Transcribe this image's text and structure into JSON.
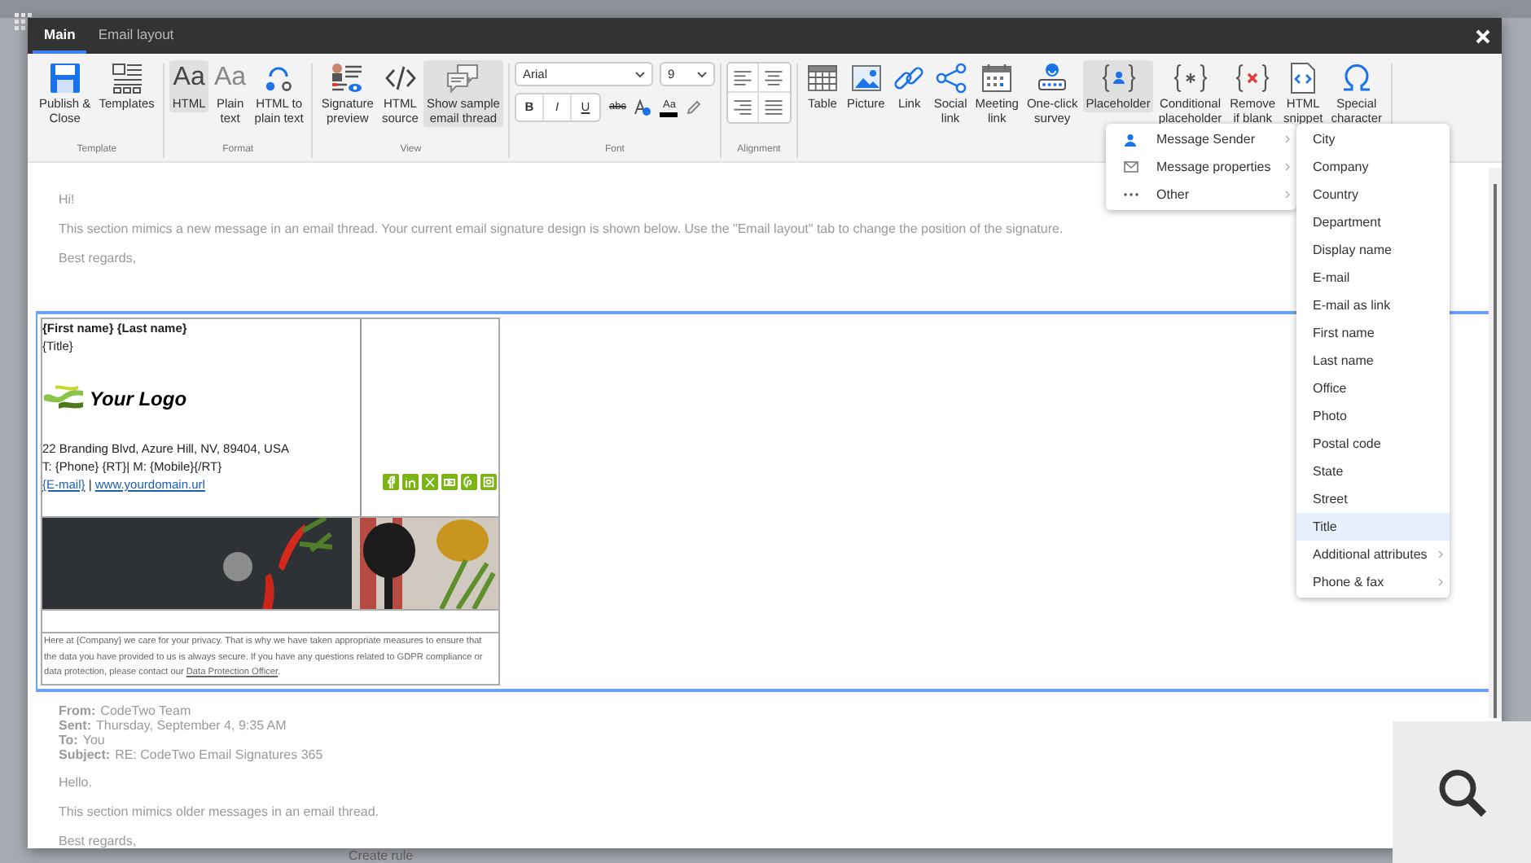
{
  "background": {
    "footer_text": "Create rule"
  },
  "window": {
    "tabs": [
      {
        "label": "Main",
        "selected": true
      },
      {
        "label": "Email layout",
        "selected": false
      }
    ]
  },
  "ribbon": {
    "groups": [
      {
        "label": "Template",
        "kind": "buttons",
        "buttons": [
          {
            "label": "Publish &\nClose",
            "kind": "save",
            "pressed": false
          },
          {
            "label": "Templates",
            "kind": "templates",
            "pressed": false
          }
        ]
      },
      {
        "label": "Format",
        "kind": "buttons",
        "buttons": [
          {
            "label": "HTML",
            "kind": "glyph",
            "glyph": "Aa",
            "pressed": true
          },
          {
            "label": "Plain\ntext",
            "kind": "glyph",
            "glyph": "Aa",
            "pressed": false
          },
          {
            "label": "HTML to\nplain text",
            "kind": "convert",
            "pressed": false
          }
        ]
      },
      {
        "label": "View",
        "kind": "buttons",
        "buttons": [
          {
            "label": "Signature\npreview",
            "kind": "preview",
            "pressed": false
          },
          {
            "label": "HTML\nsource",
            "kind": "code",
            "pressed": false
          },
          {
            "label": "Show sample\nemail thread",
            "kind": "chat",
            "pressed": true
          }
        ]
      },
      {
        "label": "Font",
        "kind": "font",
        "font": "Arial",
        "size": "9",
        "tools": [
          {
            "kind": "bold",
            "label": "B"
          },
          {
            "kind": "italic",
            "label": "I"
          },
          {
            "kind": "underline",
            "label": "U"
          },
          {
            "kind": "strike",
            "label": "abc"
          },
          {
            "kind": "highlight"
          },
          {
            "kind": "color",
            "label": "Aa"
          },
          {
            "kind": "pencil"
          }
        ]
      },
      {
        "label": "Alignment",
        "kind": "align",
        "tools": [
          {
            "kind": "left"
          },
          {
            "kind": "center"
          },
          {
            "kind": "right"
          },
          {
            "kind": "justify"
          }
        ]
      },
      {
        "kind": "buttons",
        "buttons": [
          {
            "label": "Table",
            "kind": "table",
            "pressed": false
          },
          {
            "label": "Picture",
            "kind": "picture",
            "pressed": false
          },
          {
            "label": "Link",
            "kind": "link",
            "pressed": false
          },
          {
            "label": "Social\nlink",
            "kind": "share",
            "pressed": false
          },
          {
            "label": "Meeting\nlink",
            "kind": "calendar",
            "pressed": false
          },
          {
            "label": "One-click\nsurvey",
            "kind": "survey",
            "pressed": false
          },
          {
            "label": "Placeholder",
            "kind": "braces-person",
            "pressed": true
          },
          {
            "label": "Conditional\nplaceholder",
            "kind": "braces-star",
            "pressed": false
          },
          {
            "label": "Remove\nif blank",
            "kind": "braces-x",
            "pressed": false
          },
          {
            "label": "HTML\nsnippet",
            "kind": "file-code",
            "pressed": false
          },
          {
            "label": "Special\ncharacter",
            "kind": "omega",
            "pressed": false
          }
        ]
      }
    ]
  },
  "message": {
    "lines": [
      "Hi!",
      "This section mimics a new message in an email thread. Your current email signature design is shown below. Use the \"Email layout\" tab to change the position of the signature.",
      "Best regards,"
    ]
  },
  "signature": {
    "name": "{First name} {Last name}",
    "title": "{Title}",
    "logo_text": "Your Logo",
    "address": "22 Branding Blvd, Azure Hill, NV, 89404, USA",
    "phones": "T: {Phone} {RT}| M: {Mobile}{/RT}",
    "email_link": "{E-mail}",
    "separator": " | ",
    "web_link": "www.yourdomain.url",
    "disclaimer": "Here at {Company} we care for your privacy. That is why we have taken appropriate measures to ensure that the data you have provided to us is always secure. If you have any questions related to GDPR compliance or data protection, please contact our ",
    "disclaimer_link": "Data Protection Officer",
    "disclaimer_end": "."
  },
  "thread": {
    "headers": [
      {
        "label": "From:",
        "value": "CodeTwo Team"
      },
      {
        "label": "Sent:",
        "value": "Thursday, September 4, 9:35 AM"
      },
      {
        "label": "To:",
        "value": "You"
      },
      {
        "label": "Subject:",
        "value": "RE: CodeTwo Email Signatures 365"
      }
    ],
    "lines": [
      "Hello.",
      "This section mimics older messages in an email thread.",
      "Best regards,"
    ]
  },
  "placeholder_menu": {
    "items": [
      {
        "label": "Message Sender",
        "kind": "person"
      },
      {
        "label": "Message properties",
        "kind": "mail"
      },
      {
        "label": "Other",
        "kind": "dots"
      }
    ],
    "submenu": [
      {
        "label": "City",
        "selected": false,
        "submenu": false
      },
      {
        "label": "Company",
        "selected": false,
        "submenu": false
      },
      {
        "label": "Country",
        "selected": false,
        "submenu": false
      },
      {
        "label": "Department",
        "selected": false,
        "submenu": false
      },
      {
        "label": "Display name",
        "selected": false,
        "submenu": false
      },
      {
        "label": "E-mail",
        "selected": false,
        "submenu": false
      },
      {
        "label": "E-mail as link",
        "selected": false,
        "submenu": false
      },
      {
        "label": "First name",
        "selected": false,
        "submenu": false
      },
      {
        "label": "Last name",
        "selected": false,
        "submenu": false
      },
      {
        "label": "Office",
        "selected": false,
        "submenu": false
      },
      {
        "label": "Photo",
        "selected": false,
        "submenu": false
      },
      {
        "label": "Postal code",
        "selected": false,
        "submenu": false
      },
      {
        "label": "State",
        "selected": false,
        "submenu": false
      },
      {
        "label": "Street",
        "selected": false,
        "submenu": false
      },
      {
        "label": "Title",
        "selected": true,
        "submenu": false
      },
      {
        "label": "Additional attributes",
        "selected": false,
        "submenu": true
      },
      {
        "label": "Phone & fax",
        "selected": false,
        "submenu": true
      }
    ]
  }
}
